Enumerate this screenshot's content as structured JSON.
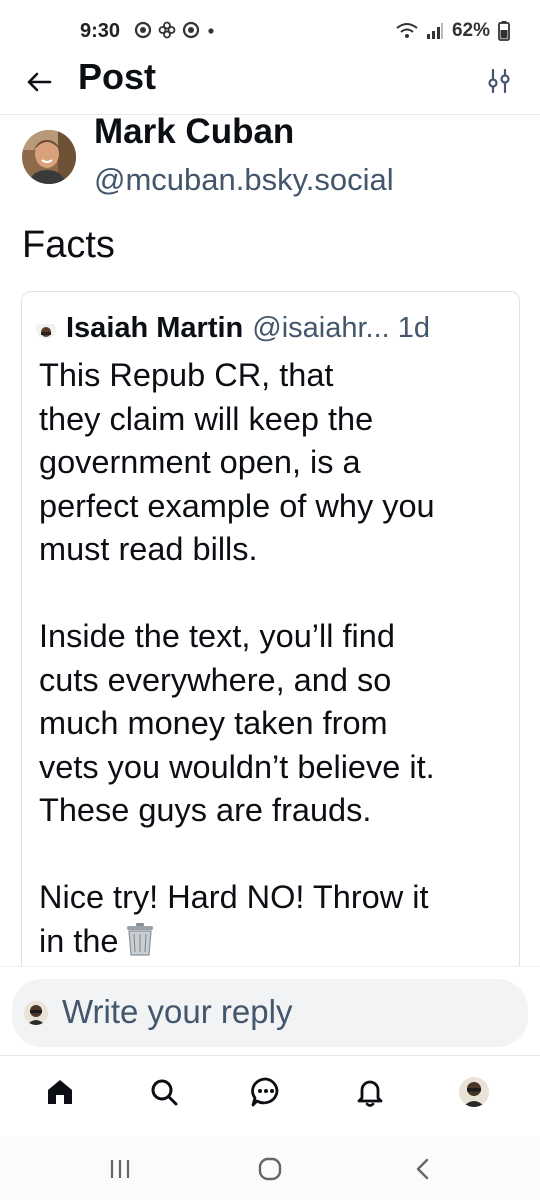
{
  "status_bar": {
    "time": "9:30",
    "battery": "62%",
    "left_icons": [
      "record-icon",
      "pinwheel-icon",
      "record-icon",
      "dot-icon"
    ],
    "right_icons": [
      "wifi-icon",
      "signal-icon",
      "battery-icon"
    ]
  },
  "header": {
    "title": "Post",
    "back_icon": "arrow-left-icon",
    "settings_icon": "sliders-icon"
  },
  "post": {
    "author_name": "Mark Cuban",
    "author_handle": "@mcuban.bsky.social",
    "text": "Facts"
  },
  "quote": {
    "author_name": "Isaiah Martin",
    "author_handle": "@isaiahr...",
    "time": "1d",
    "lines": [
      "This Repub CR, that",
      "they claim will keep the",
      "government open, is a",
      "perfect example of why you",
      "must read bills."
    ],
    "lines2": [
      "Inside the text, you’ll find",
      "cuts everywhere, and so",
      "much money taken from",
      "vets you wouldn’t believe it.",
      "These guys are frauds."
    ],
    "lines3": [
      "Nice try! Hard NO! Throw it",
      "in the"
    ],
    "emoji": "trash-can-icon"
  },
  "reply": {
    "placeholder": "Write your reply"
  },
  "bottom_nav": {
    "items": [
      "home-icon",
      "search-icon",
      "chat-icon",
      "bell-icon",
      "profile-avatar"
    ]
  },
  "system_nav": {
    "items": [
      "recents-icon",
      "home-circle-icon",
      "back-chevron-icon"
    ]
  },
  "colors": {
    "text_primary": "#0b0f14",
    "text_secondary": "#43566b",
    "accent": "#1083fe",
    "border": "#dde3ea",
    "reply_bg": "#f1f3f5"
  }
}
